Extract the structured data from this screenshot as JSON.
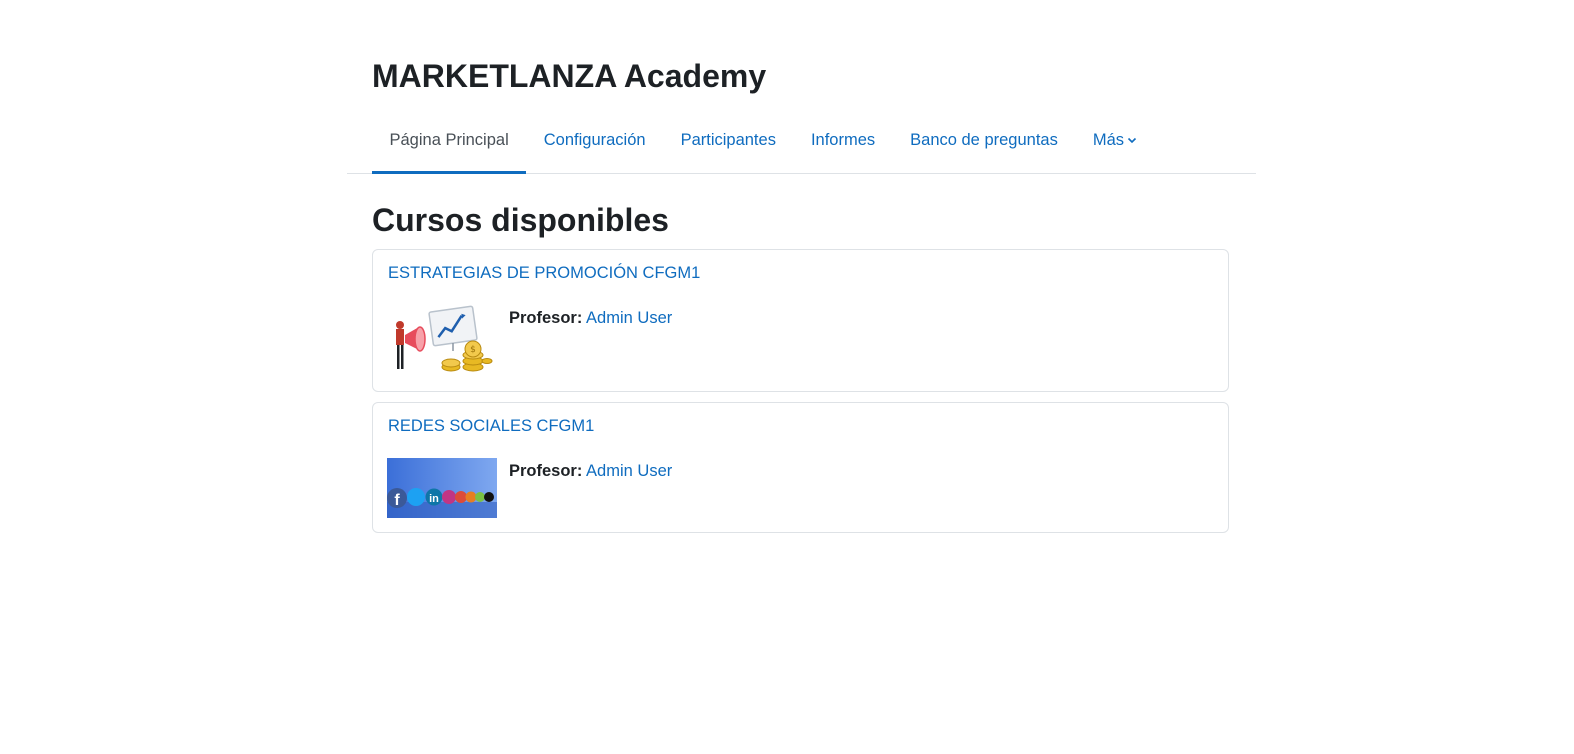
{
  "site": {
    "title": "MARKETLANZA Academy"
  },
  "nav": {
    "tabs": [
      {
        "label": "Página Principal",
        "active": true
      },
      {
        "label": "Configuración"
      },
      {
        "label": "Participantes"
      },
      {
        "label": "Informes"
      },
      {
        "label": "Banco de preguntas"
      },
      {
        "label": "Más",
        "icon": "chevron-down-icon"
      }
    ]
  },
  "main": {
    "title": "Cursos disponibles",
    "courses": [
      {
        "name": "ESTRATEGIAS DE PROMOCIÓN CFGM1",
        "image": "promotion-illustration",
        "teacher_label": "Profesor:",
        "teacher_name": "Admin User"
      },
      {
        "name": "REDES SOCIALES CFGM1",
        "image": "social-media-icons-banner",
        "teacher_label": "Profesor:",
        "teacher_name": "Admin User"
      }
    ]
  },
  "colors": {
    "link": "#0f6cbf",
    "text": "#1d2125",
    "border": "#dee2e6",
    "active_tab_text": "#495057"
  }
}
